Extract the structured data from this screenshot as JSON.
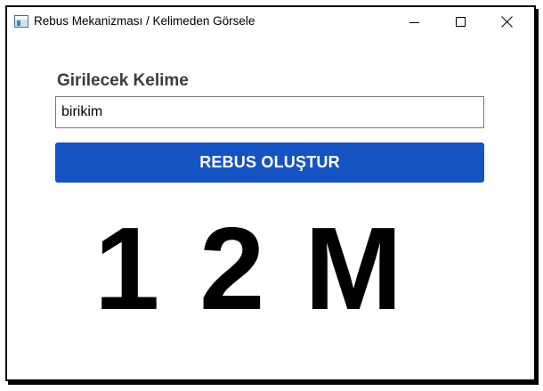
{
  "window": {
    "title": "Rebus Mekanizması / Kelimeden Görsele",
    "icon": "app-window-icon"
  },
  "form": {
    "label": "Girilecek Kelime",
    "input_value": "birikim",
    "button_label": "REBUS OLUŞTUR"
  },
  "result": {
    "rebus_text": "1 2 M"
  },
  "colors": {
    "button_bg": "#1553c2",
    "button_text": "#ffffff",
    "label_text": "#3c3c3c",
    "rebus_text": "#000000"
  }
}
